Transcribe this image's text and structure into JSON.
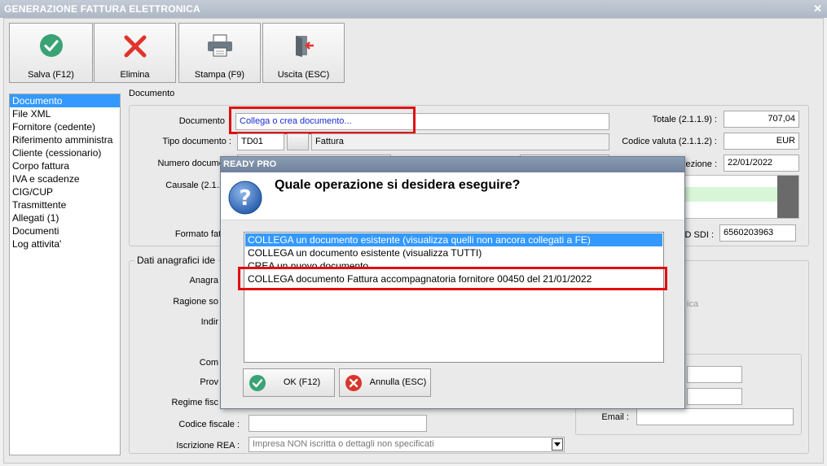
{
  "window": {
    "title": "GENERAZIONE FATTURA ELETTRONICA",
    "close_glyph": "✕"
  },
  "toolbar": [
    {
      "label": "Salva (F12)",
      "icon": "check-circle-icon"
    },
    {
      "label": "Elimina",
      "icon": "red-x-icon"
    },
    {
      "label": "Stampa (F9)",
      "icon": "printer-icon"
    },
    {
      "label": "Uscita (ESC)",
      "icon": "exit-door-icon"
    }
  ],
  "nav": {
    "items": [
      "Documento",
      "File XML",
      "Fornitore (cedente)",
      "Riferimento amministra",
      "Cliente (cessionario)",
      "Corpo fattura",
      "IVA e scadenze",
      "CIG/CUP",
      "Trasmittente",
      "Allegati (1)",
      "Documenti",
      "Log attivita'"
    ],
    "selected": 0
  },
  "documento": {
    "group_title": "Documento",
    "documento_label": "Documento",
    "documento_value": "Collega o crea documento...",
    "tipo_label": "Tipo documento :",
    "tipo_code": "TD01",
    "tipo_desc": "Fattura",
    "numero_label": "Numero document",
    "causale_label": "Causale (2.1.1.1",
    "formato_label": "Formato fattur",
    "totale_label": "Totale (2.1.1.9) :",
    "totale_value": "707,04",
    "valuta_label": "Codice valuta (2.1.1.2) :",
    "valuta_value": "EUR",
    "data_label": "ezione :",
    "data_value": "22/01/2022",
    "sdi_label": "D SDI :",
    "sdi_value": "6560203963"
  },
  "anagrafici": {
    "group_title": "Dati anagrafici ide",
    "anagra_label": "Anagra",
    "ragione_label": "Ragione so",
    "indir_label": "Indir",
    "com_label": "Com",
    "prov_label": "Prov",
    "regime_label": "Regime fisc",
    "cf_label": "Codice fiscale :",
    "rea_label": "Iscrizione REA :",
    "rea_value": "Impresa NON iscritta o dettagli non specificati",
    "email_label": "Email :",
    "ica_text": "ica"
  },
  "dialog": {
    "title": "READY PRO",
    "question": "Quale operazione si desidera eseguire?",
    "options": [
      "COLLEGA un documento esistente (visualizza quelli non ancora collegati a FE)",
      "COLLEGA un documento esistente (visualizza TUTTI)",
      "CREA un nuovo documento",
      "COLLEGA documento Fattura accompagnatoria fornitore 00450 del 21/01/2022"
    ],
    "selected": 0,
    "ok_label": "OK (F12)",
    "cancel_label": "Annulla (ESC)"
  }
}
